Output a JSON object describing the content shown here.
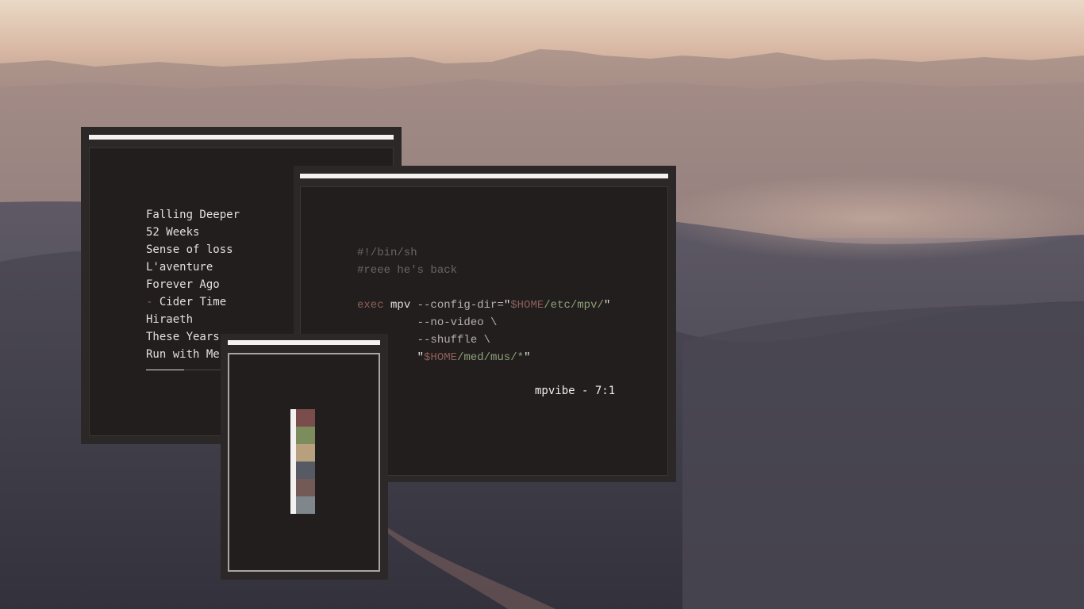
{
  "playlist": {
    "tracks": [
      {
        "marker": "",
        "title": "Falling Deeper"
      },
      {
        "marker": "",
        "title": "52 Weeks"
      },
      {
        "marker": "",
        "title": "Sense of loss"
      },
      {
        "marker": "",
        "title": "L'aventure"
      },
      {
        "marker": "",
        "title": "Forever Ago"
      },
      {
        "marker": "-",
        "title": " Cider Time"
      },
      {
        "marker": "",
        "title": "Hiraeth"
      },
      {
        "marker": "",
        "title": "These Years"
      },
      {
        "marker": "",
        "title": "Run with Me"
      }
    ],
    "progress_fraction": 0.5
  },
  "script": {
    "shebang": "#!/bin/sh",
    "comment": "#reee he's back",
    "line1": {
      "kw": "exec",
      "cmd": " mpv ",
      "opt": "--config-dir=",
      "q1": "\"",
      "var": "$HOME",
      "path": "/etc/mpv/",
      "q2": "\""
    },
    "line2": "--no-video \\",
    "line3": "--shuffle \\",
    "line4": {
      "q1": "\"",
      "var": "$HOME",
      "path": "/med/mus/*",
      "q2": "\""
    },
    "now_playing": "mpvibe - 7:1"
  },
  "palette": {
    "swatches": [
      "#7a4c4c",
      "#7d8c5c",
      "#b8a07f",
      "#565a64",
      "#745a56",
      "#7f878c"
    ]
  },
  "colors": {
    "window_bg": "#2b2827",
    "accent_red": "#8e5e5a",
    "accent_green": "#8fa07a",
    "text": "#e4dfdc"
  }
}
